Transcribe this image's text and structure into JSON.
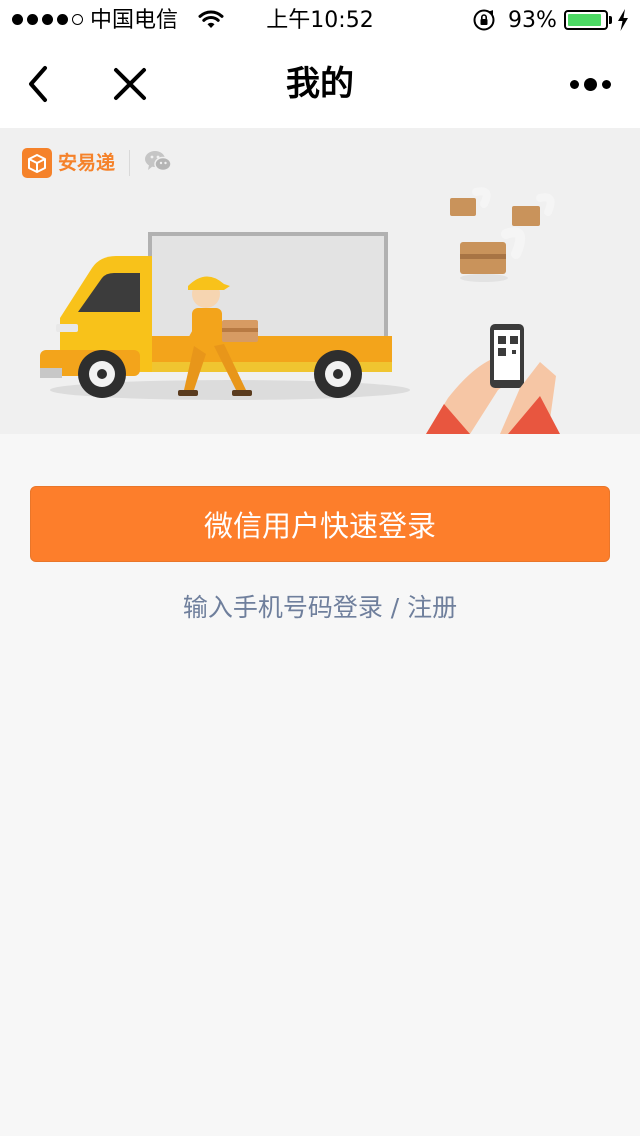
{
  "status_bar": {
    "carrier": "中国电信",
    "time": "上午10:52",
    "battery_percent": "93%",
    "battery_level": 0.93,
    "signal_bars_filled": 4,
    "signal_bars_total": 5
  },
  "nav": {
    "title": "我的",
    "back_icon": "chevron-left-icon",
    "close_icon": "close-icon",
    "more_icon": "more-dots-icon"
  },
  "banner": {
    "brand_name": "安易递",
    "brand_icon": "package-box-icon",
    "secondary_icon": "wechat-icon"
  },
  "actions": {
    "wechat_login_label": "微信用户快速登录",
    "phone_login_label": "输入手机号码登录",
    "separator": " / ",
    "register_label": "注册"
  },
  "colors": {
    "accent": "#fd7e2b",
    "link": "#6f7f9c",
    "brand": "#f5822a",
    "battery": "#4cd964"
  }
}
